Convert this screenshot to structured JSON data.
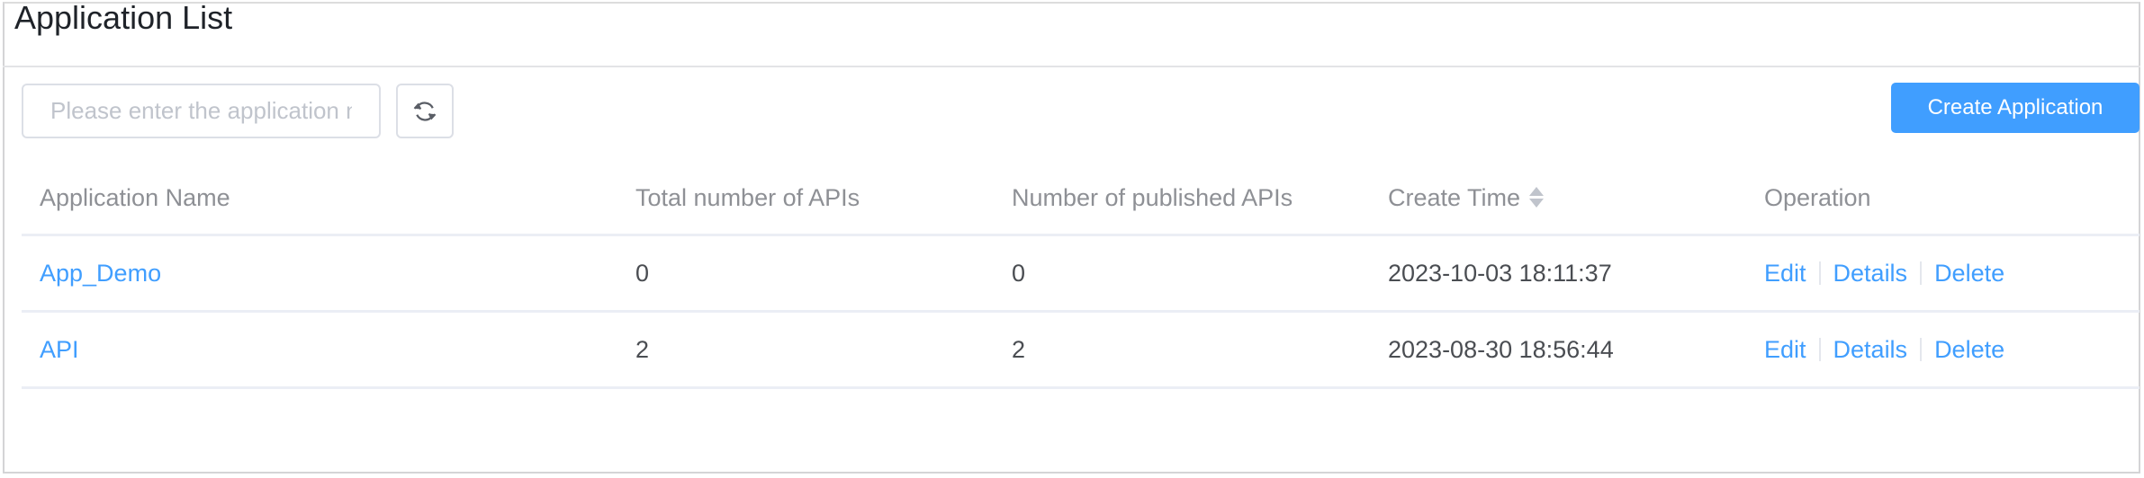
{
  "page": {
    "title": "Application List"
  },
  "toolbar": {
    "search_placeholder": "Please enter the application name",
    "search_value": "",
    "refresh_icon": "refresh-icon",
    "create_label": "Create Application"
  },
  "table": {
    "columns": [
      {
        "label": "Application Name"
      },
      {
        "label": "Total number of APIs"
      },
      {
        "label": "Number of published APIs"
      },
      {
        "label": "Create Time",
        "sortable": true,
        "sort_icon": "sort-caret-icon"
      },
      {
        "label": "Operation"
      }
    ],
    "rows": [
      {
        "name": "App_Demo",
        "total_apis": "0",
        "published_apis": "0",
        "create_time": "2023-10-03 18:11:37",
        "actions": {
          "edit": "Edit",
          "details": "Details",
          "delete": "Delete"
        }
      },
      {
        "name": "API",
        "total_apis": "2",
        "published_apis": "2",
        "create_time": "2023-08-30 18:56:44",
        "actions": {
          "edit": "Edit",
          "details": "Details",
          "delete": "Delete"
        }
      }
    ]
  },
  "colors": {
    "accent": "#409eff",
    "header_text": "#8e9095",
    "body_text": "#4a4d52",
    "border": "#ebeef5"
  }
}
